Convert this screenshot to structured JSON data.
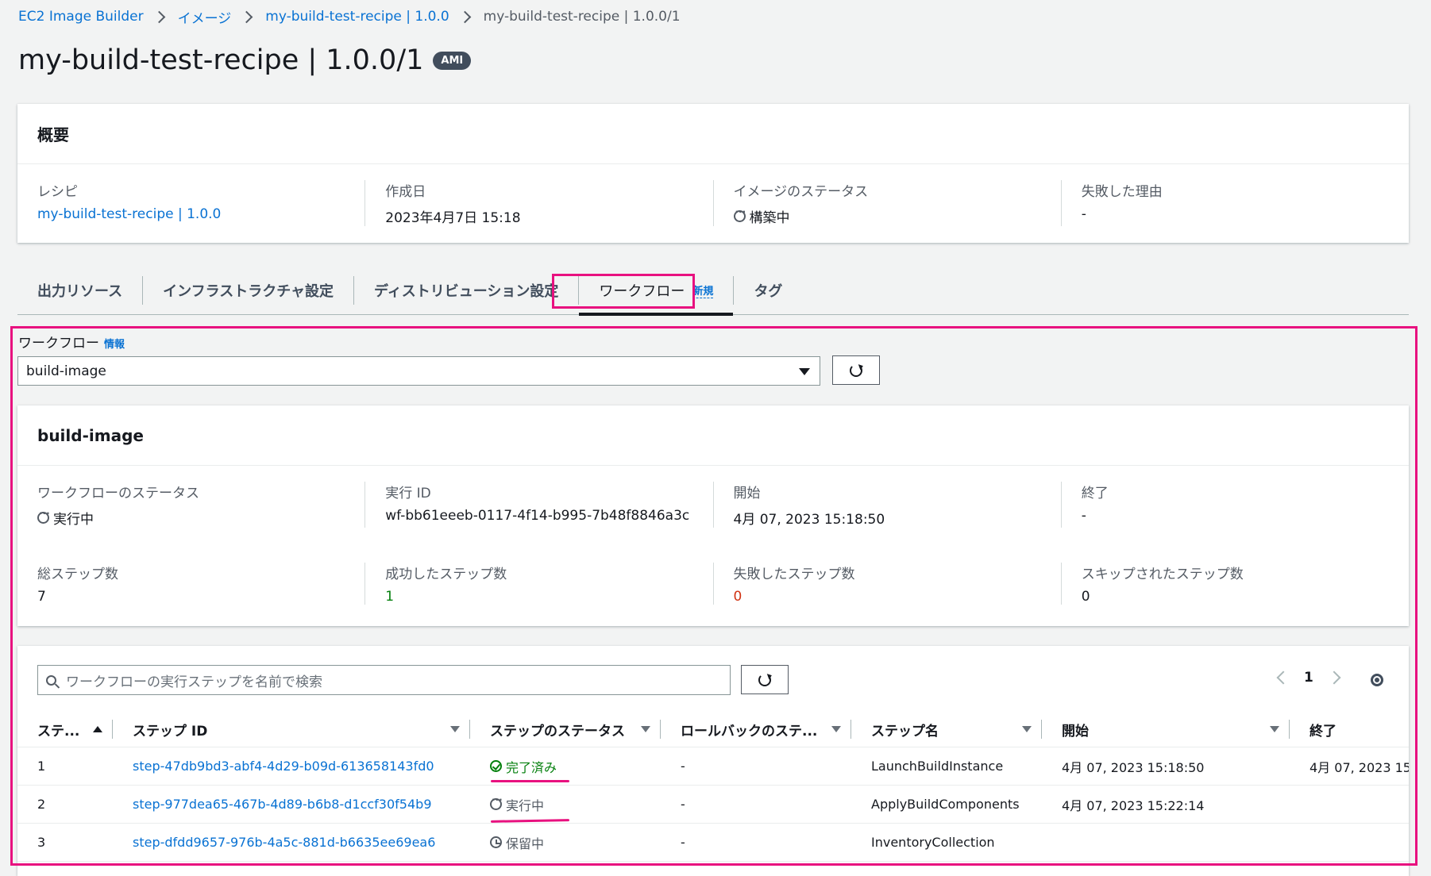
{
  "breadcrumb": [
    "EC2 Image Builder",
    "イメージ",
    "my-build-test-recipe | 1.0.0",
    "my-build-test-recipe | 1.0.0/1"
  ],
  "page_title": "my-build-test-recipe | 1.0.0/1",
  "page_badge": "AMI",
  "summary": {
    "heading": "概要",
    "fields": [
      {
        "label": "レシピ",
        "value": "my-build-test-recipe | 1.0.0"
      },
      {
        "label": "作成日",
        "value": "2023年4月7日 15:18"
      },
      {
        "label": "イメージのステータス",
        "value": "構築中"
      },
      {
        "label": "失敗した理由",
        "value": "-"
      }
    ]
  },
  "tabs": [
    "出力リソース",
    "インフラストラクチャ設定",
    "ディストリビューション設定",
    "ワークフロー",
    "タグ"
  ],
  "tab_new_label": "新規",
  "workflow": {
    "label": "ワークフロー",
    "info": "情報",
    "selected": "build-image"
  },
  "detail": {
    "heading": "build-image",
    "row1": [
      {
        "label": "ワークフローのステータス",
        "value": "実行中"
      },
      {
        "label": "実行 ID",
        "value": "wf-bb61eeeb-0117-4f14-b995-7b48f8846a3c"
      },
      {
        "label": "開始",
        "value": "4月 07, 2023 15:18:50"
      },
      {
        "label": "終了",
        "value": "-"
      }
    ],
    "row2": [
      {
        "label": "総ステップ数",
        "value": "7"
      },
      {
        "label": "成功したステップ数",
        "value": "1"
      },
      {
        "label": "失敗したステップ数",
        "value": "0"
      },
      {
        "label": "スキップされたステップ数",
        "value": "0"
      }
    ]
  },
  "steps": {
    "search_placeholder": "ワークフローの実行ステップを名前で検索",
    "page": "1",
    "columns": [
      "ステ...",
      "ステップ ID",
      "ステップのステータス",
      "ロールバックのステ...",
      "ステップ名",
      "開始",
      "終了"
    ],
    "rows": [
      {
        "num": "1",
        "id": "step-47db9bd3-abf4-4d29-b09d-613658143fd0",
        "status": "完了済み",
        "rollback": "-",
        "name": "LaunchBuildInstance",
        "start": "4月 07, 2023 15:18:50",
        "end": "4月 07, 2023 15:"
      },
      {
        "num": "2",
        "id": "step-977dea65-467b-4d89-b6b8-d1ccf30f54b9",
        "status": "実行中",
        "rollback": "-",
        "name": "ApplyBuildComponents",
        "start": "4月 07, 2023 15:22:14",
        "end": ""
      },
      {
        "num": "3",
        "id": "step-dfdd9657-976b-4a5c-881d-b6635ee69ea6",
        "status": "保留中",
        "rollback": "-",
        "name": "InventoryCollection",
        "start": "",
        "end": ""
      }
    ]
  },
  "colors": {
    "link": "#0972d3",
    "success": "#037f0c",
    "error": "#d13212",
    "highlight": "#e8117f"
  }
}
